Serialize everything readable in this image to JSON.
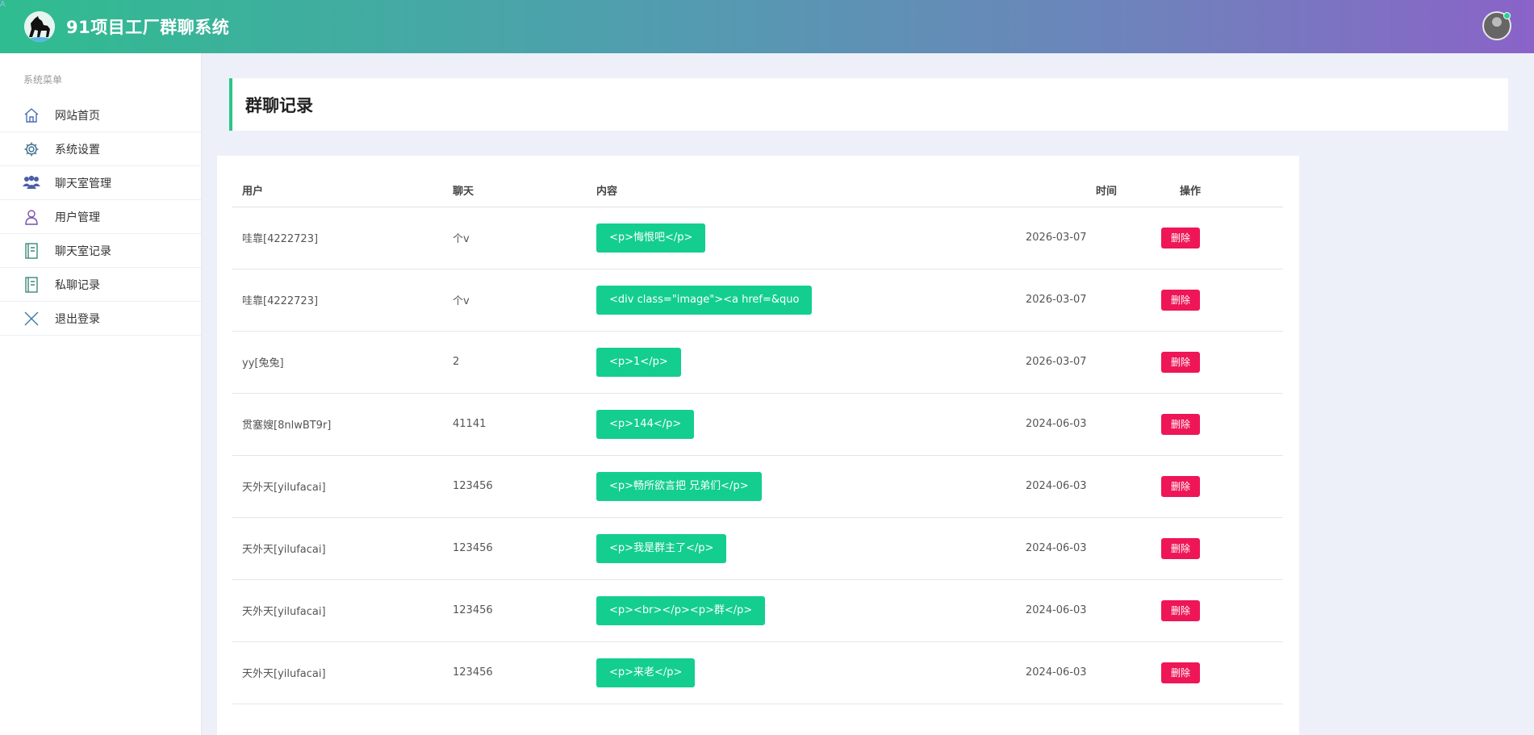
{
  "app": {
    "title": "91项目工厂群聊系统",
    "brand_gradient": [
      "#2fbd8f",
      "#8a63c8"
    ],
    "corner_glyph": "A"
  },
  "sidebar": {
    "header": "系统菜单",
    "items": [
      {
        "label": "网站首页",
        "icon": "home-icon"
      },
      {
        "label": "系统设置",
        "icon": "gear-icon"
      },
      {
        "label": "聊天室管理",
        "icon": "users-icon"
      },
      {
        "label": "用户管理",
        "icon": "user-icon"
      },
      {
        "label": "聊天室记录",
        "icon": "notebook-icon"
      },
      {
        "label": "私聊记录",
        "icon": "notebook-icon"
      },
      {
        "label": "退出登录",
        "icon": "close-icon"
      }
    ]
  },
  "page": {
    "title": "群聊记录"
  },
  "table": {
    "columns": [
      "用户",
      "聊天",
      "内容",
      "时间",
      "操作"
    ],
    "rows": [
      {
        "user": "哇靠[4222723]",
        "chat": "个v",
        "content": "<p>悔恨吧</p>",
        "time": "2026-03-07",
        "action": "删除"
      },
      {
        "user": "哇靠[4222723]",
        "chat": "个v",
        "content": "<div class=\"image\"><a href=&quo",
        "time": "2026-03-07",
        "action": "删除"
      },
      {
        "user": "yy[兔兔]",
        "chat": "2",
        "content": "<p>1</p>",
        "time": "2026-03-07",
        "action": "删除"
      },
      {
        "user": "贯塞嫂[8nlwBT9r]",
        "chat": "41141",
        "content": "<p>144</p>",
        "time": "2024-06-03",
        "action": "删除"
      },
      {
        "user": "天外天[yilufacai]",
        "chat": "123456",
        "content": "<p>畅所欲言把 兄弟们</p>",
        "time": "2024-06-03",
        "action": "删除"
      },
      {
        "user": "天外天[yilufacai]",
        "chat": "123456",
        "content": "<p>我是群主了</p>",
        "time": "2024-06-03",
        "action": "删除"
      },
      {
        "user": "天外天[yilufacai]",
        "chat": "123456",
        "content": "<p><br></p><p>群</p>",
        "time": "2024-06-03",
        "action": "删除"
      },
      {
        "user": "天外天[yilufacai]",
        "chat": "123456",
        "content": "<p>来老</p>",
        "time": "2024-06-03",
        "action": "删除"
      }
    ]
  },
  "colors": {
    "tag": "#13ce8f",
    "delete": "#ee1657",
    "accent": "#2bc48a",
    "background": "#edf0f9"
  }
}
